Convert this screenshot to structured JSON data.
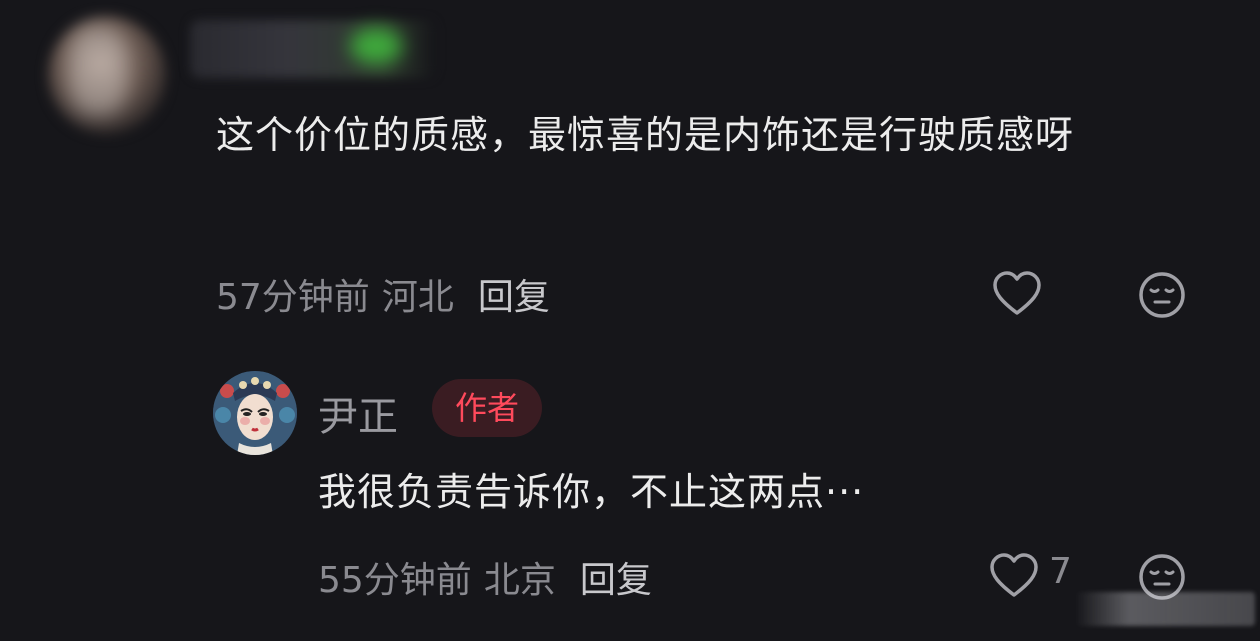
{
  "comment": {
    "avatar_icon": "blurred-avatar",
    "username_icon": "blurred-username",
    "text": "这个价位的质感，最惊喜的是内饰还是行驶质感呀",
    "time": "57分钟前",
    "region": "河北",
    "reply_label": "回复",
    "like_icon": "heart-outline-icon",
    "dislike_icon": "neutral-face-icon"
  },
  "reply": {
    "avatar_icon": "opera-mask-avatar",
    "author": "尹正",
    "badge": "作者",
    "text": "我很负责告诉你，不止这两点···",
    "time": "55分钟前",
    "region": "北京",
    "reply_label": "回复",
    "like_icon": "heart-outline-icon",
    "like_count": "7",
    "dislike_icon": "neutral-face-icon"
  },
  "colors": {
    "background": "#16161a",
    "primary_text": "#ececec",
    "secondary_text": "#8a8a90",
    "badge_text": "#ff4a5c",
    "badge_bg": "#3a1c22"
  }
}
